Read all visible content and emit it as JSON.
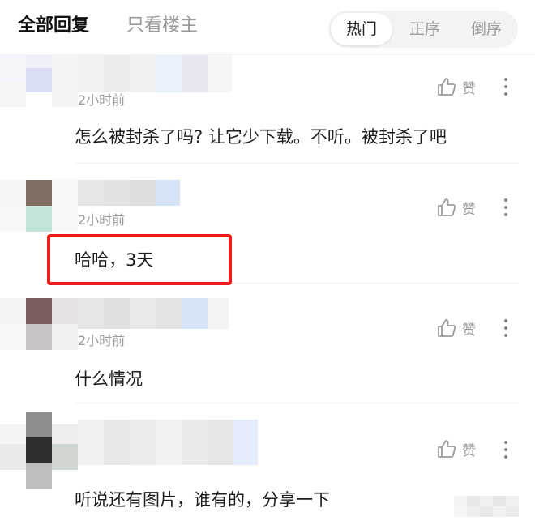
{
  "header": {
    "tab_all": "全部回复",
    "tab_op_only": "只看楼主",
    "sort": {
      "hot": "热门",
      "asc": "正序",
      "desc": "倒序",
      "active": "hot"
    }
  },
  "comments": [
    {
      "time": "2小时前",
      "text": "怎么被封杀了吗? 让它少下载。不听。被封杀了吧",
      "like_label": "赞"
    },
    {
      "time": "2小时前",
      "text": "哈哈，3天",
      "like_label": "赞",
      "highlighted": true
    },
    {
      "time": "2小时前",
      "text": "什么情况",
      "like_label": "赞"
    },
    {
      "time": "2小时前",
      "text": "听说还有图片，谁有的，分享一下",
      "like_label": "赞"
    }
  ],
  "colors": {
    "highlight": "#ee1c1c",
    "muted": "#9a9a9a",
    "text": "#1d1d1d"
  },
  "icons": {
    "like": "thumbs-up-icon",
    "more": "more-vertical-icon"
  }
}
